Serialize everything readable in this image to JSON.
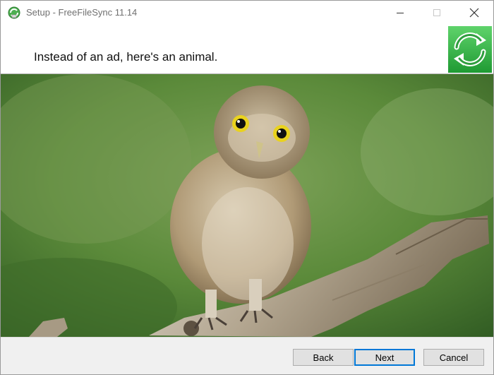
{
  "window": {
    "title": "Setup - FreeFileSync 11.14",
    "icon": "freefilesync-app-icon"
  },
  "header": {
    "title": "Instead of an ad, here's an animal.",
    "logo": "freefilesync-logo"
  },
  "image": {
    "subject": "owl-photo"
  },
  "footer": {
    "back_label": "Back",
    "next_label": "Next",
    "cancel_label": "Cancel"
  },
  "colors": {
    "accent": "#0078d7",
    "logo_green": "#39b54a"
  }
}
